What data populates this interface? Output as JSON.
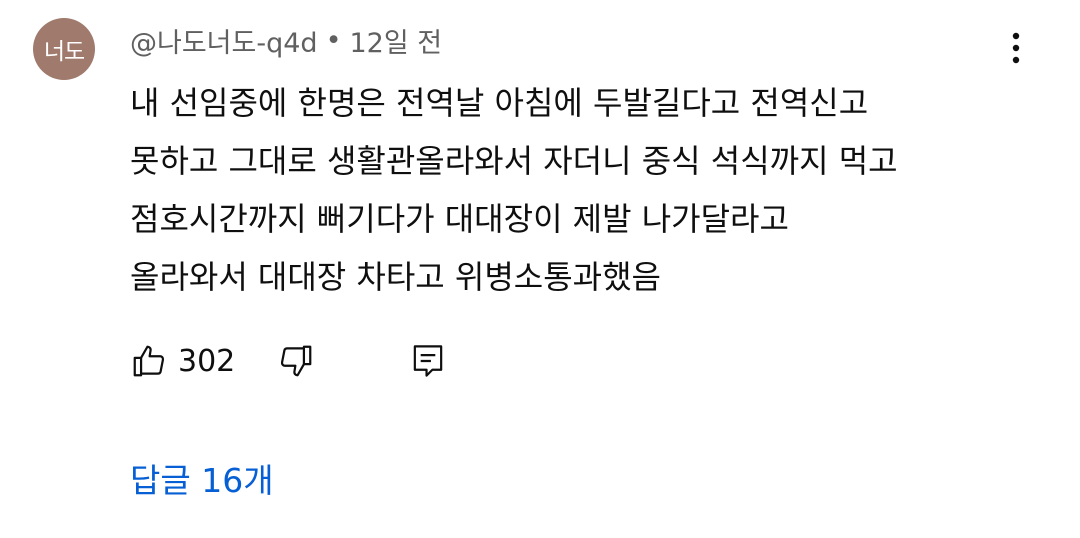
{
  "comment": {
    "avatar_text": "너도",
    "author": "@나도너도-q4d",
    "separator": "•",
    "timestamp": "12일 전",
    "body_lines": [
      "내 선임중에 한명은 전역날 아침에 두발길다고 전역신고",
      "못하고 그대로 생활관올라와서 자더니 중식 석식까지 먹고",
      "점호시간까지 뻐기다가 대대장이 제발 나가달라고",
      "올라와서 대대장 차타고 위병소통과했음"
    ],
    "like_count": "302",
    "replies_label": "답글 16개"
  },
  "icons": {
    "more": "more-vert-icon",
    "like": "thumb-up-icon",
    "dislike": "thumb-down-icon",
    "reply": "comment-reply-icon"
  },
  "colors": {
    "avatar_bg": "#a07a6c",
    "meta_text": "#606060",
    "body_text": "#0f0f0f",
    "link": "#065fd4"
  }
}
